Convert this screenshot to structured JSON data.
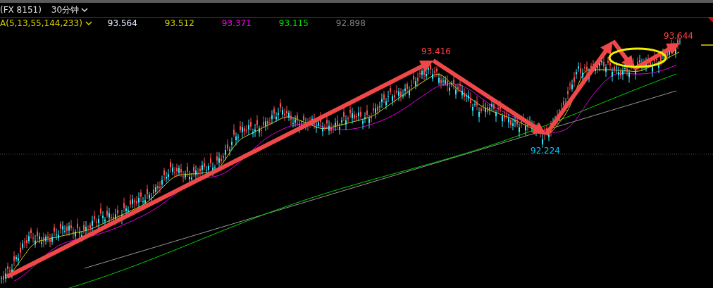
{
  "header": {
    "symbol": "(FX 8151)",
    "period": "30分钟"
  },
  "ma_legend": {
    "label": "A(5,13,55,144,233)",
    "values": [
      {
        "text": "93.564",
        "color": "#e8f0ff"
      },
      {
        "text": "93.512",
        "color": "#d4d400"
      },
      {
        "text": "93.371",
        "color": "#ff00ff"
      },
      {
        "text": "93.115",
        "color": "#00e000"
      },
      {
        "text": "92.898",
        "color": "#808080"
      }
    ]
  },
  "price_labels": [
    {
      "text": "93.416",
      "color": "#ff4040"
    },
    {
      "text": "92.224",
      "color": "#00c8ff"
    },
    {
      "text": "93.644",
      "color": "#ff4040"
    }
  ]
}
